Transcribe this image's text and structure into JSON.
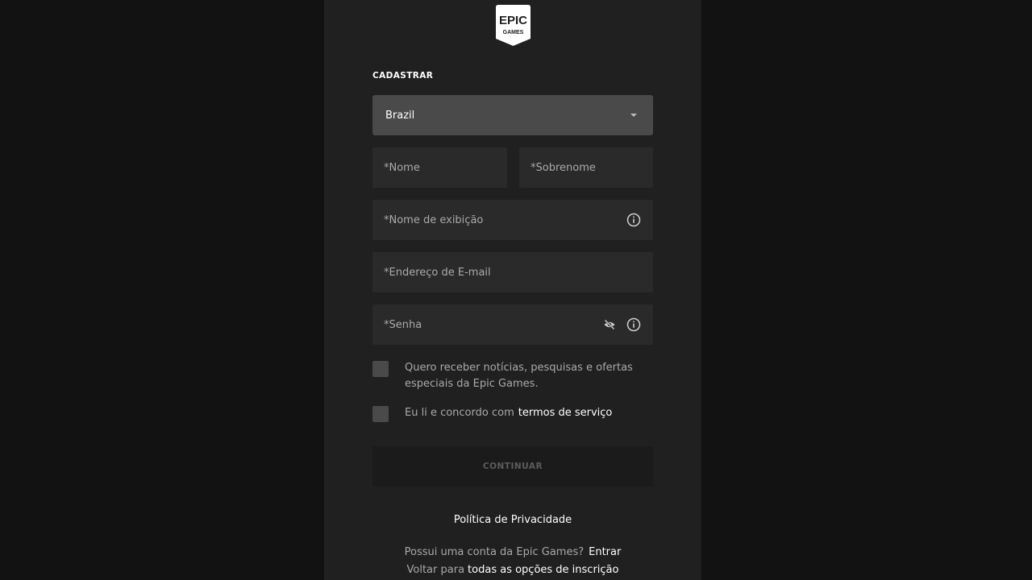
{
  "logo": {
    "line1": "EPIC",
    "line2": "GAMES"
  },
  "form": {
    "title": "CADASTRAR",
    "country": {
      "value": "Brazil"
    },
    "fields": {
      "first_name": "*Nome",
      "last_name": "*Sobrenome",
      "display_name": "*Nome de exibição",
      "email": "*Endereço de E-mail",
      "password": "*Senha"
    },
    "newsletter_label": "Quero receber notícias, pesquisas e ofertas especiais da Epic Games.",
    "tos_prefix": "Eu li e concordo com",
    "tos_link": "termos de serviço",
    "continue_label": "CONTINUAR"
  },
  "footer": {
    "privacy": "Política de Privacidade",
    "have_account": "Possui uma conta da Epic Games?",
    "sign_in": "Entrar",
    "back_prefix": "Voltar para",
    "all_options": "todas as opções de inscrição"
  },
  "icons": {
    "logo": "epic-games-logo",
    "select": "caret-down-icon",
    "info": "info-icon",
    "eye": "eye-off-icon"
  },
  "colors": {
    "background": "#121212",
    "panel": "#202020",
    "input": "#2a2a2a",
    "select": "#4a4a4a",
    "text_muted": "#a9a9a9"
  }
}
